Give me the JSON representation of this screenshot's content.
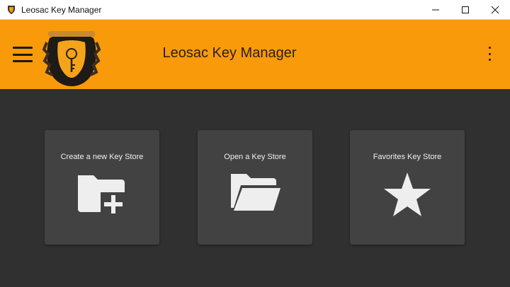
{
  "window": {
    "title": "Leosac Key Manager",
    "controls": [
      "minimize",
      "maximize",
      "close"
    ]
  },
  "appbar": {
    "title": "Leosac Key Manager",
    "menu_icon": "hamburger-menu-icon",
    "more_icon": "more-vertical-icon",
    "accent_color": "#f89a0a"
  },
  "cards": [
    {
      "label": "Create a new Key Store",
      "icon": "folder-plus-icon"
    },
    {
      "label": "Open a Key Store",
      "icon": "folder-open-icon"
    },
    {
      "label": "Favorites Key Store",
      "icon": "star-icon"
    }
  ]
}
